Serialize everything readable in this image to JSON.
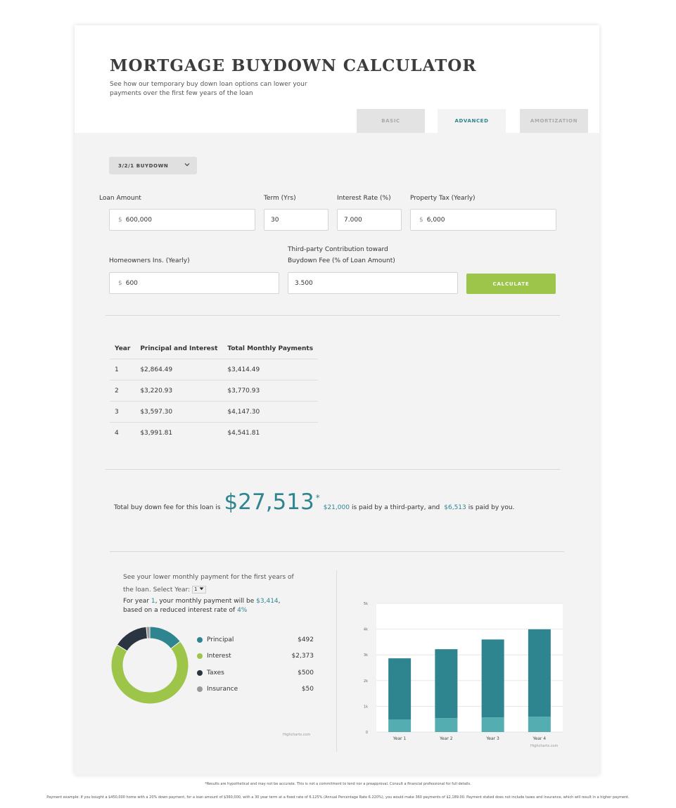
{
  "header": {
    "title": "MORTGAGE BUYDOWN CALCULATOR",
    "subtitle": "See how our temporary buy down loan options can lower your payments over the first few years of the loan"
  },
  "tabs": [
    {
      "label": "BASIC",
      "active": false
    },
    {
      "label": "ADVANCED",
      "active": true
    },
    {
      "label": "AMORTIZATION",
      "active": false
    }
  ],
  "buydown_select": {
    "value": "3/2/1 BUYDOWN"
  },
  "form": {
    "loan_amount": {
      "label": "Loan Amount",
      "currency": "$",
      "value": "600,000"
    },
    "term": {
      "label": "Term (Yrs)",
      "value": "30"
    },
    "interest_rate": {
      "label": "Interest Rate (%)",
      "value": "7.000"
    },
    "property_tax": {
      "label": "Property Tax (Yearly)",
      "currency": "$",
      "value": "6,000"
    },
    "homeowners_ins": {
      "label": "Homeowners Ins. (Yearly)",
      "currency": "$",
      "value": "600"
    },
    "contribution": {
      "label_line1": "Third-party Contribution toward",
      "label_line2": "Buydown Fee (% of Loan Amount)",
      "value": "3.500"
    },
    "calculate_label": "CALCULATE"
  },
  "payment_table": {
    "headers": [
      "Year",
      "Principal and Interest",
      "Total Monthly Payments"
    ],
    "rows": [
      [
        "1",
        "$2,864.49",
        "$3,414.49"
      ],
      [
        "2",
        "$3,220.93",
        "$3,770.93"
      ],
      [
        "3",
        "$3,597.30",
        "$4,147.30"
      ],
      [
        "4",
        "$3,991.81",
        "$4,541.81"
      ]
    ]
  },
  "fee_summary": {
    "prefix": "Total buy down fee for this loan is",
    "total": "$27,513",
    "asterisk": "*",
    "third_party_amount": "$21,000",
    "third_party_text": "is paid by a third-party, and",
    "you_amount": "$6,513",
    "you_text": "is paid by you."
  },
  "breakdown": {
    "intro_line1": "See your lower monthly payment for the first years of",
    "intro_line2": "the loan. Select Year:",
    "selected_year": "1",
    "year_text_1": "For year",
    "year_value": "1",
    "year_text_2": ", your monthly payment will be",
    "payment_value": "$3,414",
    "year_text_3": ",",
    "rate_text": "based on a reduced interest rate of",
    "rate_value": "4%",
    "credit": "Highcharts.com",
    "items": [
      {
        "name": "Principal",
        "amount": "$492",
        "value": 492,
        "color": "#2e858f"
      },
      {
        "name": "Interest",
        "amount": "$2,373",
        "value": 2373,
        "color": "#9dc54a"
      },
      {
        "name": "Taxes",
        "amount": "$500",
        "value": 500,
        "color": "#2b3541"
      },
      {
        "name": "Insurance",
        "amount": "$50",
        "value": 50,
        "color": "#999999"
      }
    ]
  },
  "chart_data": {
    "type": "bar",
    "stacked": true,
    "categories": [
      "Year 1",
      "Year 2",
      "Year 3",
      "Year 4"
    ],
    "series": [
      {
        "values": [
          492,
          540,
          570,
          600
        ],
        "color": "#54adb0"
      },
      {
        "values": [
          2373,
          2680,
          3027,
          3392
        ],
        "color": "#2e858f"
      }
    ],
    "ylim": [
      0,
      5000
    ],
    "yticks": [
      0,
      1000,
      2000,
      3000,
      4000,
      5000
    ],
    "ytick_labels": [
      "0",
      "1k",
      "2k",
      "3k",
      "4k",
      "5k"
    ],
    "grid": true,
    "credit": "Highcharts.com"
  },
  "footer": {
    "disclaimer": "*Results are hypothetical and may not be accurate. This is not a commitment to lend nor a preapproval. Consult a financial professional for full details.",
    "example": "Payment example: If you bought a $450,000 home with a 20% down payment, for a loan amount of $360,000, with a 30 year term at a fixed rate of 6.125% (Annual Percentage Rate 6.220%), you would make 360 payments of $2,189.00. Payment stated does not include taxes and insurance, which will result in a higher payment."
  }
}
